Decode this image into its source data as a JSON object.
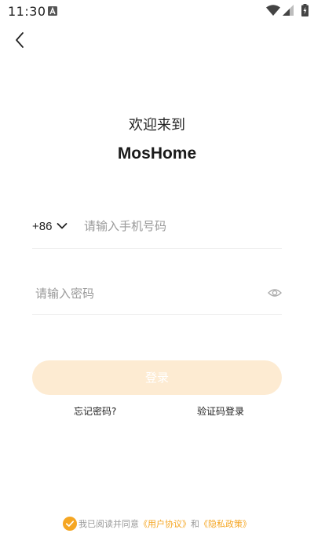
{
  "status_bar": {
    "time": "11:30",
    "icons": [
      "notification-a-icon",
      "wifi-icon",
      "signal-icon",
      "battery-charging-icon"
    ]
  },
  "header": {
    "back_icon": "chevron-left-icon"
  },
  "welcome": {
    "greeting": "欢迎来到",
    "app_name": "MosHome"
  },
  "phone": {
    "country_code": "+86",
    "placeholder": "请输入手机号码",
    "value": ""
  },
  "password": {
    "placeholder": "请输入密码",
    "value": "",
    "toggle_icon": "eye-icon"
  },
  "actions": {
    "login_label": "登录",
    "forgot_password": "忘记密码?",
    "code_login": "验证码登录"
  },
  "agreement": {
    "checked": true,
    "prefix": "我已阅读并同意",
    "user_agreement": "《用户协议》",
    "conjunction": "和",
    "privacy_policy": "《隐私政策》"
  },
  "colors": {
    "accent": "#f5a623",
    "button_disabled_bg": "#fdebd2",
    "placeholder": "#9a9a9a",
    "divider": "#f0f0f0"
  }
}
